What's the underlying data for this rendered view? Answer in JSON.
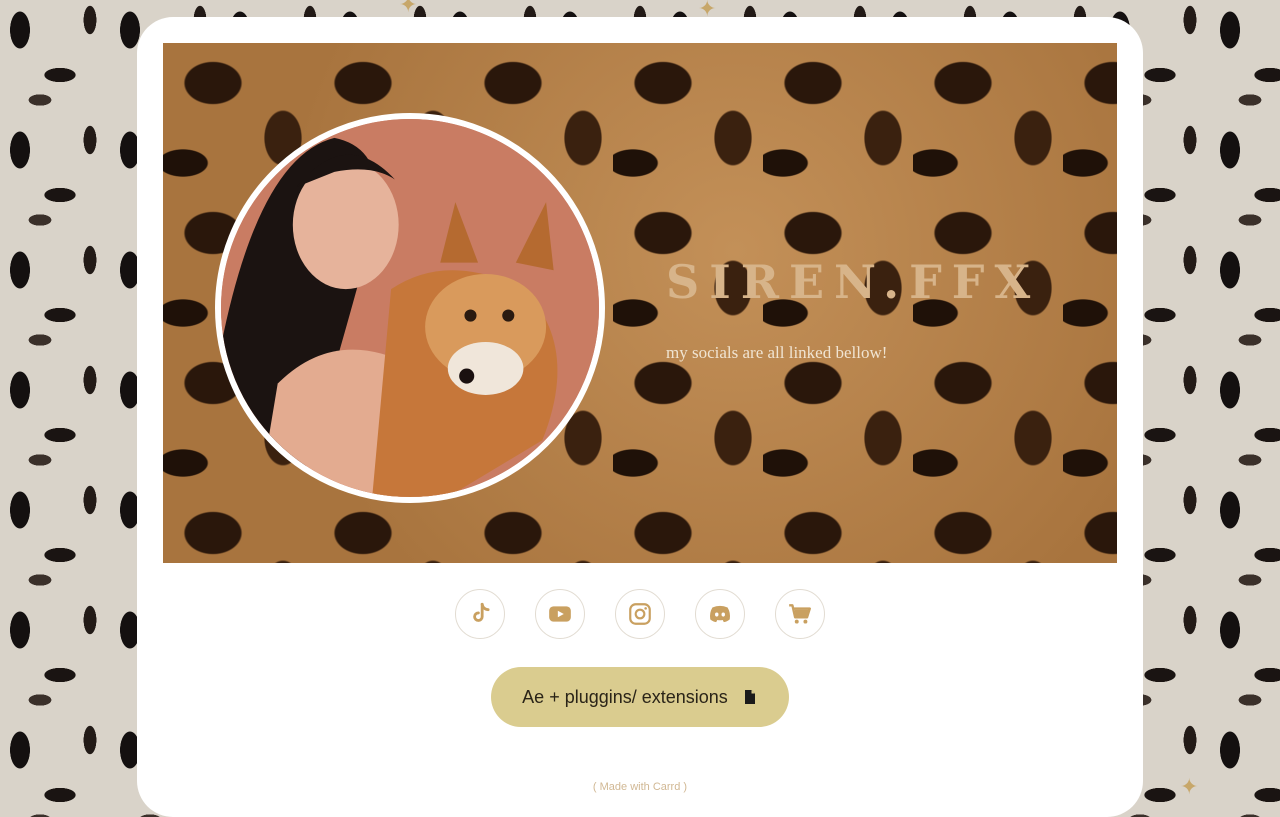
{
  "profile": {
    "title": "SIREN.FFX",
    "subtitle": "my socials are all linked bellow!"
  },
  "socials": [
    {
      "icon": "tiktok-icon"
    },
    {
      "icon": "youtube-icon"
    },
    {
      "icon": "instagram-icon"
    },
    {
      "icon": "discord-icon"
    },
    {
      "icon": "cart-icon"
    }
  ],
  "cta": {
    "label": "Ae + pluggins/ extensions",
    "icon": "file-icon"
  },
  "footer": {
    "text": "( Made with Carrd )"
  },
  "colors": {
    "accent": "#c9a060",
    "button_bg": "#dacc8f",
    "title": "#d7b48a"
  }
}
